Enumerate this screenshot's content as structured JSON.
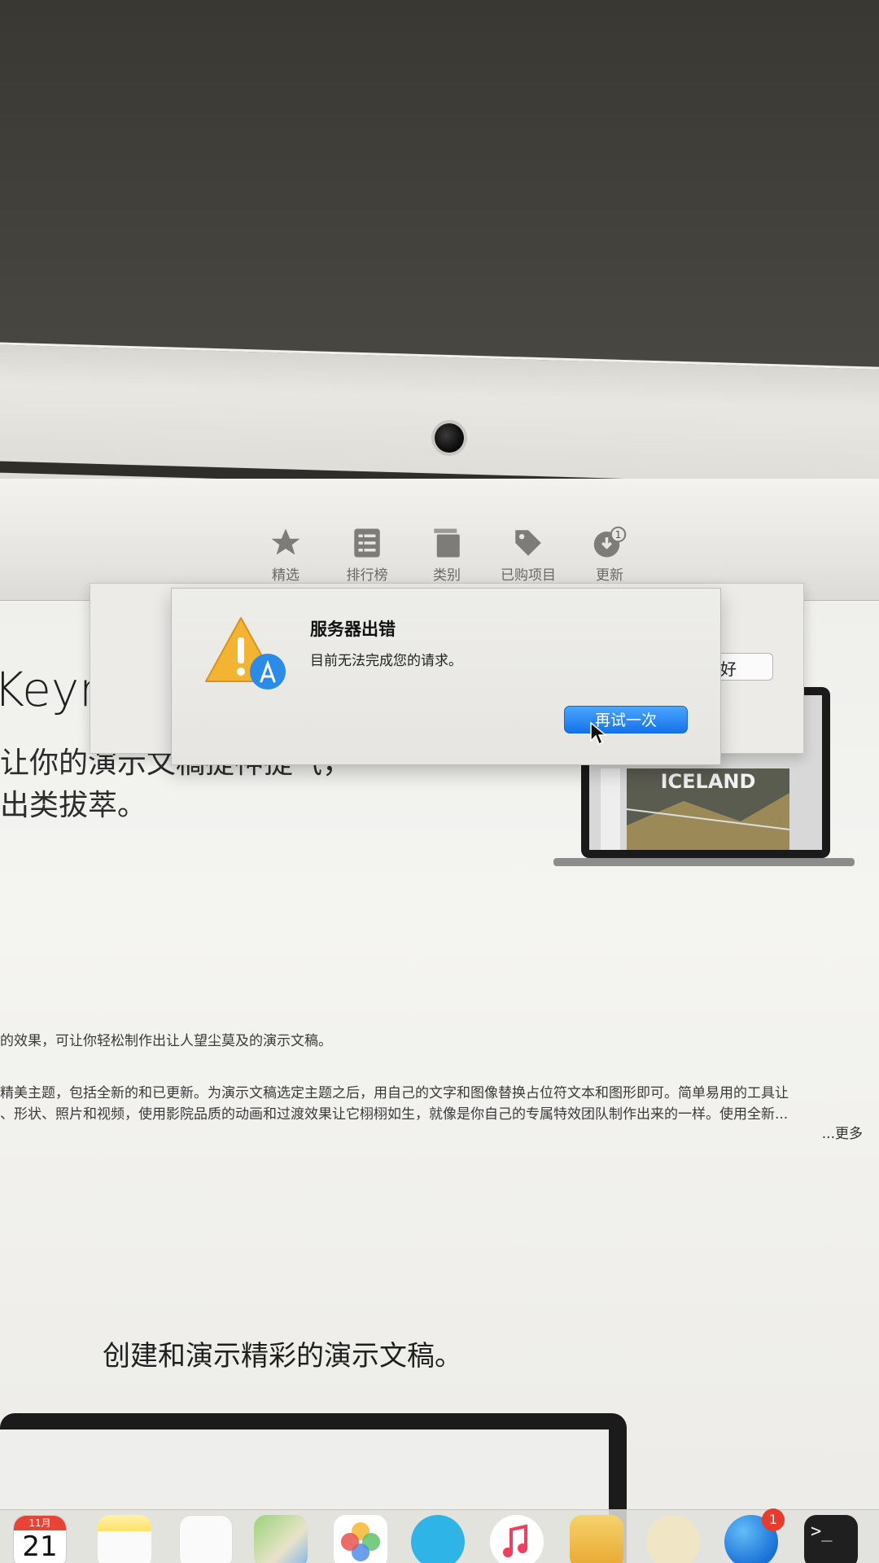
{
  "toolbar": {
    "tabs": [
      {
        "label": "精选",
        "icon": "star-icon"
      },
      {
        "label": "排行榜",
        "icon": "list-icon"
      },
      {
        "label": "类别",
        "icon": "stack-icon"
      },
      {
        "label": "已购项目",
        "icon": "tag-icon"
      },
      {
        "label": "更新",
        "icon": "download-badge-icon",
        "badge": "1"
      }
    ]
  },
  "app": {
    "name": "Keyn",
    "tagline_line1": "让你的演示文稿提神提气，",
    "tagline_line2": "出类拔萃。",
    "description_lines": [
      "的效果，可让你轻松制作出让人望尘莫及的演示文稿。",
      "精美主题，包括全新的和已更新。为演示文稿选定主题之后，用自己的文字和图像替换占位符文本和图形即可。简单易用的工具让",
      "、形状、照片和视频，使用影院品质的动画和过渡效果让它栩栩如生，就像是你自己的专属特效团队制作出来的一样。使用全新..."
    ],
    "more_link": "...更多",
    "section_title": "创建和演示精彩的演示文稿。",
    "preview_title": "ICELAND"
  },
  "background_sheet": {
    "ok_label": "好"
  },
  "dialog": {
    "title": "服务器出错",
    "message": "目前无法完成您的请求。",
    "retry_label": "再试一次"
  },
  "dock": {
    "calendar_month": "11月",
    "calendar_day": "21",
    "appstore_badge": "1",
    "terminal_glyph": ">_"
  },
  "colors": {
    "accent_blue": "#1572e8",
    "badge_red": "#ea3a2e",
    "alert_yellow": "#f3b431"
  }
}
